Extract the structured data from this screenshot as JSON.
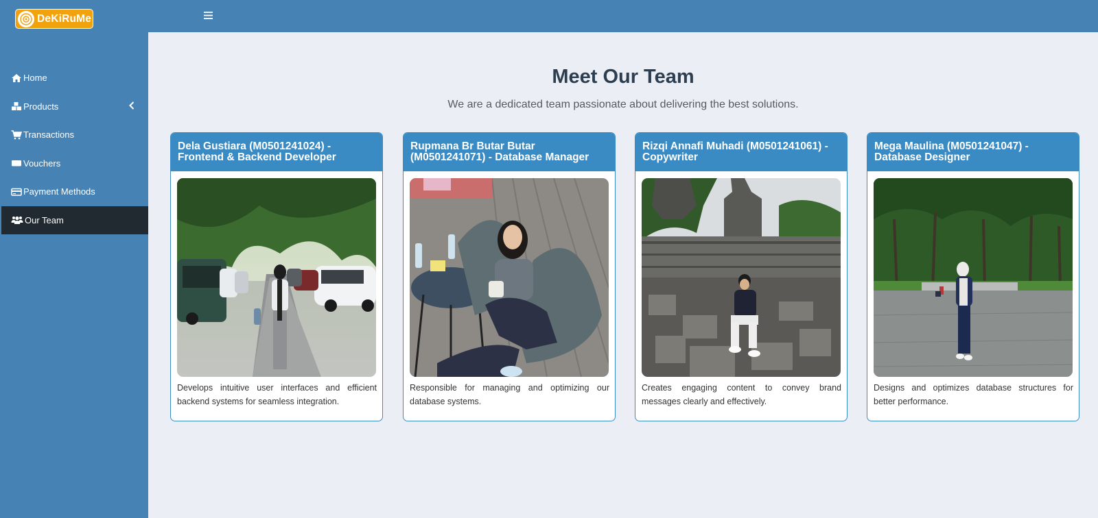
{
  "brand": {
    "name": "DeKiRuMe"
  },
  "nav": {
    "items": [
      {
        "label": "Home",
        "icon": "home-icon"
      },
      {
        "label": "Products",
        "icon": "boxes-icon"
      },
      {
        "label": "Transactions",
        "icon": "cart-icon"
      },
      {
        "label": "Vouchers",
        "icon": "ticket-icon"
      },
      {
        "label": "Payment Methods",
        "icon": "credit-card-icon"
      },
      {
        "label": "Our Team",
        "icon": "users-icon",
        "active": true
      }
    ]
  },
  "page": {
    "title": "Meet Our Team",
    "subtitle": "We are a dedicated team passionate about delivering the best solutions."
  },
  "team": [
    {
      "header": "Dela Gustiara (M0501241024) - Frontend & Backend Developer",
      "description": "Develops intuitive user interfaces and efficient backend systems for seamless integration."
    },
    {
      "header": "Rupmana Br Butar Butar (M0501241071) - Database Manager",
      "description": "Responsible for managing and optimizing our database systems."
    },
    {
      "header": "Rizqi Annafi Muhadi (M0501241061) - Copywriter",
      "description": "Creates engaging content to convey brand messages clearly and effectively."
    },
    {
      "header": "Mega Maulina (M0501241047) - Database Designer",
      "description": "Designs and optimizes database structures for better performance."
    }
  ],
  "colors": {
    "sidebar": "#4682b4",
    "active_nav": "#212a30",
    "card_header": "#3a8bc3",
    "page_bg": "#ebeff5",
    "brand": "#f2a20c"
  }
}
